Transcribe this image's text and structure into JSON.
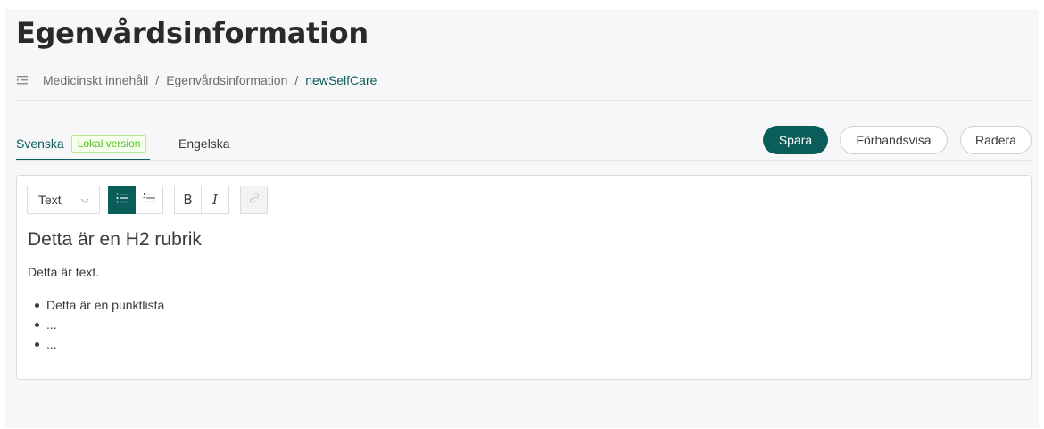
{
  "page": {
    "title": "Egenvårdsinformation"
  },
  "breadcrumb": {
    "icon": "list-menu-icon",
    "items": [
      "Medicinskt innehåll",
      "Egenvårdsinformation",
      "newSelfCare"
    ],
    "separator": "/"
  },
  "tabs": {
    "svenska": {
      "label": "Svenska",
      "badge": "Lokal version",
      "active": true
    },
    "engelska": {
      "label": "Engelska",
      "active": false
    }
  },
  "actions": {
    "save": "Spara",
    "preview": "Förhandsvisa",
    "delete": "Radera"
  },
  "toolbar": {
    "text_style": "Text",
    "bullet_list_active": true,
    "icons": [
      "bullet-list-icon",
      "numbered-list-icon",
      "bold-icon",
      "italic-icon",
      "link-icon"
    ],
    "bold_glyph": "B",
    "italic_glyph": "I"
  },
  "editor": {
    "heading": "Detta är en H2 rubrik",
    "paragraph": "Detta är text.",
    "bullets": [
      "Detta är en punktlista",
      "...",
      "..."
    ]
  },
  "colors": {
    "accent": "#0b5d5a",
    "badge_green": "#52c41a"
  }
}
